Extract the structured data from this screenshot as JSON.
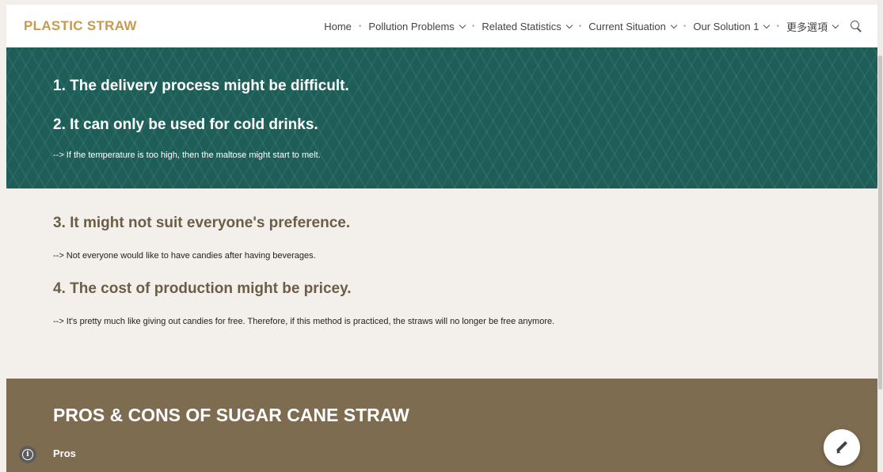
{
  "header": {
    "brand": "PLASTIC STRAW",
    "nav": [
      {
        "label": "Home",
        "has_dropdown": false
      },
      {
        "label": "Pollution Problems",
        "has_dropdown": true
      },
      {
        "label": "Related Statistics",
        "has_dropdown": true
      },
      {
        "label": "Current Situation",
        "has_dropdown": true
      },
      {
        "label": "Our Solution 1",
        "has_dropdown": true
      },
      {
        "label": "更多選項",
        "has_dropdown": true
      }
    ],
    "search_icon": "search-icon"
  },
  "teal_section": {
    "color": "#1e5e58",
    "heading1": "1. The delivery process might be difficult.",
    "heading2": "2. It can only be used for cold drinks.",
    "note": "--> If the temperature is too high, then the maltose might start to melt."
  },
  "light_section": {
    "heading3": "3. It might not suit everyone's preference.",
    "note3": "--> Not everyone would like to have candies after having beverages.",
    "heading4": "4. The cost of production might be pricey.",
    "note4": "--> It's pretty much like giving out candies for free. Therefore, if this method is practiced, the straws will no longer be free anymore."
  },
  "brown_section": {
    "color": "#7e6c51",
    "title": "PROS & CONS OF SUGAR CANE STRAW",
    "subtitle": "Pros"
  },
  "colors": {
    "brand": "#c79a4c",
    "light_heading": "#6b5d46",
    "page_background": "#f3f0eb"
  },
  "icons": {
    "info": "info-icon",
    "edit": "pencil-icon"
  }
}
